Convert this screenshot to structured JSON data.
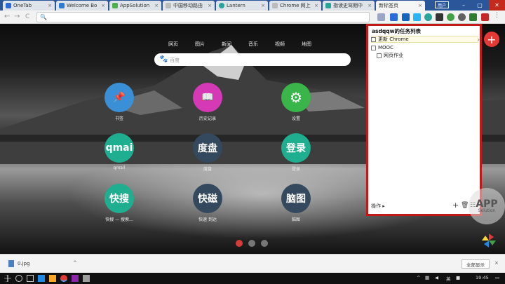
{
  "tabs": [
    {
      "title": "OneTab",
      "color": "#2b6cd6"
    },
    {
      "title": "Welcome Bo",
      "color": "#2f7bd8"
    },
    {
      "title": "AppSolution",
      "color": "#4caf50"
    },
    {
      "title": "中国移动路由",
      "color": "#bbbbbb"
    },
    {
      "title": "Lantern",
      "color": "#26a69a"
    },
    {
      "title": "Chrome 网上",
      "color": "#bbbbbb"
    },
    {
      "title": "指读史驾期中",
      "color": "#26a69a"
    },
    {
      "title": "新标签页",
      "color": "#cccccc"
    }
  ],
  "tab_close": "×",
  "window": {
    "user": "用户",
    "minimize": "–",
    "maximize": "▢",
    "close": "✕"
  },
  "toolbar": {
    "back": "←",
    "forward": "→",
    "reload": "C",
    "search_icon": "🔍"
  },
  "page": {
    "categories": [
      "网页",
      "图片",
      "新闻",
      "音乐",
      "视频",
      "地图"
    ],
    "search_placeholder": "百度",
    "search_icon": "baidu-paw-icon",
    "apps": [
      {
        "label": "书签",
        "glyph": "📌",
        "color": "#3a8fd6"
      },
      {
        "label": "历史记录",
        "glyph": "📖",
        "color": "#d639b5"
      },
      {
        "label": "设置",
        "glyph": "⚙",
        "color": "#39b54a"
      },
      {
        "label": "qmail",
        "glyph": "qmai",
        "color": "#1fae8f"
      },
      {
        "label": "度盘",
        "glyph": "度盘",
        "color": "#34495e"
      },
      {
        "label": "登录",
        "glyph": "登录",
        "color": "#1fae8f"
      },
      {
        "label": "快搜 — 搜索...",
        "glyph": "快搜",
        "color": "#1fae8f"
      },
      {
        "label": "快速 到达",
        "glyph": "快磁",
        "color": "#34495e"
      },
      {
        "label": "脑图",
        "glyph": "脑图",
        "color": "#34495e"
      }
    ],
    "page_dots": [
      "#d83b3b",
      "#888888",
      "#888888"
    ]
  },
  "todo": {
    "title": "asdqqw的任务列表",
    "items": [
      {
        "text": "更新 Chrome",
        "indent": 0,
        "selected": true
      },
      {
        "text": "MOOC",
        "indent": 0,
        "selected": false
      },
      {
        "text": "网页作业",
        "indent": 1,
        "selected": false
      }
    ],
    "actions_label": "操作 ▸",
    "add_icon": "+",
    "delete_icon": "🗑",
    "list_icon": "☷"
  },
  "float_add": "+",
  "watermark": {
    "big": "APP",
    "small": "Solution"
  },
  "download": {
    "filename": "0.jpg",
    "chevron": "^",
    "show_all": "全部显示",
    "close": "×"
  },
  "taskbar": {
    "ime": "英",
    "time": "19:45"
  },
  "colors": {
    "accent_red": "#c21818",
    "tab_strip": "#2b579a"
  }
}
